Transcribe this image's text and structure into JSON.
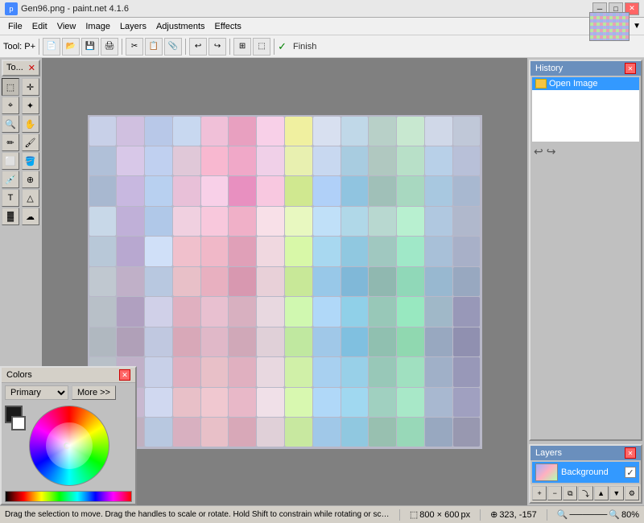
{
  "titlebar": {
    "title": "Gen96.png - paint.net 4.1.6",
    "minimize": "─",
    "maximize": "□",
    "close": "✕"
  },
  "menubar": {
    "items": [
      "File",
      "Edit",
      "View",
      "Image",
      "Layers",
      "Adjustments",
      "Effects"
    ]
  },
  "toolbar": {
    "finish_label": "Finish",
    "tool_label": "Tool: P+"
  },
  "toolpanel": {
    "title": "To...",
    "close": "✕"
  },
  "history": {
    "title": "History",
    "close": "✕",
    "items": [
      "Open Image"
    ],
    "undo": "↩",
    "redo": "↪"
  },
  "layers": {
    "title": "Layers",
    "close": "✕",
    "items": [
      {
        "name": "Background",
        "visible": true
      }
    ]
  },
  "colors": {
    "title": "Colors",
    "close": "✕",
    "primary_label": "Primary",
    "more_label": "More >>"
  },
  "statusbar": {
    "message": "Drag the selection to move. Drag the handles to scale or rotate. Hold Shift to constrain while rotating or scaling.",
    "dimensions": "800 × 600",
    "coordinates": "323, -157",
    "unit": "px",
    "zoom": "80%"
  }
}
